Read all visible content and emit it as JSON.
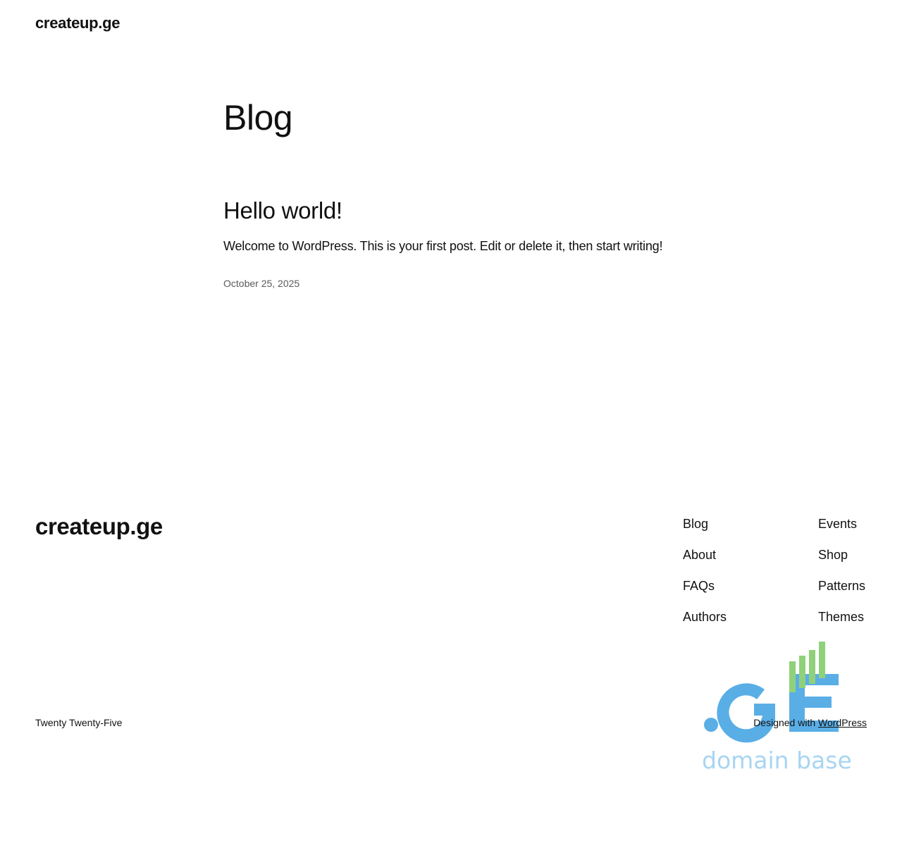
{
  "header": {
    "site_title": "createup.ge"
  },
  "main": {
    "page_title": "Blog",
    "posts": [
      {
        "title": "Hello world!",
        "excerpt": "Welcome to WordPress. This is your first post. Edit or delete it, then start writing!",
        "date": "October 25, 2025"
      }
    ]
  },
  "footer": {
    "site_title": "createup.ge",
    "nav_col1": [
      "Blog",
      "About",
      "FAQs",
      "Authors"
    ],
    "nav_col2": [
      "Events",
      "Shop",
      "Patterns",
      "Themes"
    ],
    "theme_credit": "Twenty Twenty-Five",
    "designed_with_prefix": "Designed with ",
    "designed_with_link": "WordPress"
  },
  "logo": {
    "icon": "ge-domain-logo",
    "mark": ".GE",
    "tagline": "domain base",
    "colors": {
      "blue": "#5aaee6",
      "light_blue": "#a8d5f2",
      "green": "#8fd17a"
    }
  }
}
